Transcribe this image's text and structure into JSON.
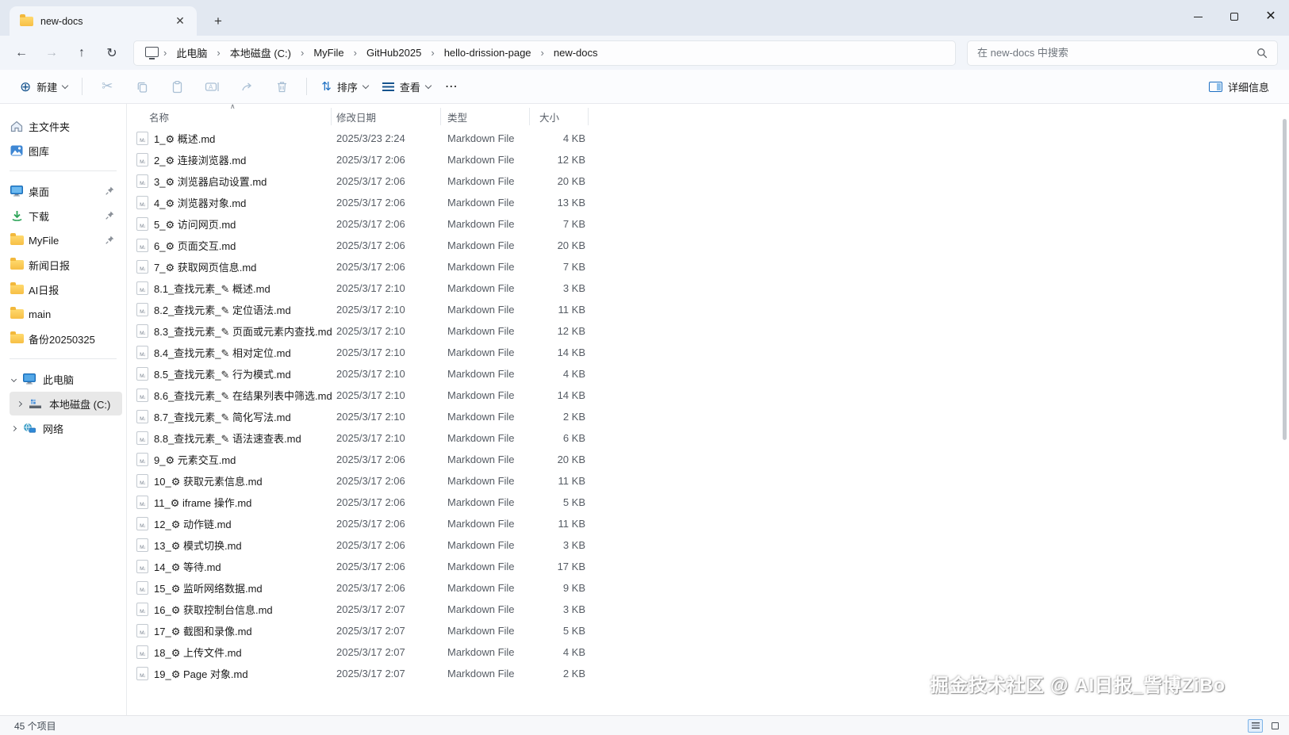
{
  "window": {
    "tab_title": "new-docs"
  },
  "breadcrumb": {
    "items": [
      "此电脑",
      "本地磁盘 (C:)",
      "MyFile",
      "GitHub2025",
      "hello-drission-page",
      "new-docs"
    ]
  },
  "search": {
    "placeholder": "在 new-docs 中搜索"
  },
  "toolbar": {
    "new_label": "新建",
    "sort_label": "排序",
    "view_label": "查看",
    "more_label": "⋯",
    "details_label": "详细信息"
  },
  "sidebar": {
    "home": "主文件夹",
    "gallery": "图库",
    "desktop": "桌面",
    "downloads": "下载",
    "myfile": "MyFile",
    "news_daily": "新闻日报",
    "ai_daily": "AI日报",
    "main": "main",
    "backup": "备份20250325",
    "this_pc": "此电脑",
    "local_disk": "本地磁盘 (C:)",
    "network": "网络"
  },
  "filelist": {
    "columns": {
      "name": "名称",
      "date": "修改日期",
      "type": "类型",
      "size": "大小"
    },
    "rows": [
      {
        "name": "1_⚙ 概述.md",
        "date": "2025/3/23 2:24",
        "type": "Markdown File",
        "size": "4 KB"
      },
      {
        "name": "2_⚙ 连接浏览器.md",
        "date": "2025/3/17 2:06",
        "type": "Markdown File",
        "size": "12 KB"
      },
      {
        "name": "3_⚙ 浏览器启动设置.md",
        "date": "2025/3/17 2:06",
        "type": "Markdown File",
        "size": "20 KB"
      },
      {
        "name": "4_⚙ 浏览器对象.md",
        "date": "2025/3/17 2:06",
        "type": "Markdown File",
        "size": "13 KB"
      },
      {
        "name": "5_⚙ 访问网页.md",
        "date": "2025/3/17 2:06",
        "type": "Markdown File",
        "size": "7 KB"
      },
      {
        "name": "6_⚙ 页面交互.md",
        "date": "2025/3/17 2:06",
        "type": "Markdown File",
        "size": "20 KB"
      },
      {
        "name": "7_⚙ 获取网页信息.md",
        "date": "2025/3/17 2:06",
        "type": "Markdown File",
        "size": "7 KB"
      },
      {
        "name": "8.1_查找元素_✎ 概述.md",
        "date": "2025/3/17 2:10",
        "type": "Markdown File",
        "size": "3 KB"
      },
      {
        "name": "8.2_查找元素_✎ 定位语法.md",
        "date": "2025/3/17 2:10",
        "type": "Markdown File",
        "size": "11 KB"
      },
      {
        "name": "8.3_查找元素_✎ 页面或元素内查找.md",
        "date": "2025/3/17 2:10",
        "type": "Markdown File",
        "size": "12 KB"
      },
      {
        "name": "8.4_查找元素_✎ 相对定位.md",
        "date": "2025/3/17 2:10",
        "type": "Markdown File",
        "size": "14 KB"
      },
      {
        "name": "8.5_查找元素_✎ 行为模式.md",
        "date": "2025/3/17 2:10",
        "type": "Markdown File",
        "size": "4 KB"
      },
      {
        "name": "8.6_查找元素_✎ 在结果列表中筛选.md",
        "date": "2025/3/17 2:10",
        "type": "Markdown File",
        "size": "14 KB"
      },
      {
        "name": "8.7_查找元素_✎ 简化写法.md",
        "date": "2025/3/17 2:10",
        "type": "Markdown File",
        "size": "2 KB"
      },
      {
        "name": "8.8_查找元素_✎ 语法速查表.md",
        "date": "2025/3/17 2:10",
        "type": "Markdown File",
        "size": "6 KB"
      },
      {
        "name": "9_⚙ 元素交互.md",
        "date": "2025/3/17 2:06",
        "type": "Markdown File",
        "size": "20 KB"
      },
      {
        "name": "10_⚙ 获取元素信息.md",
        "date": "2025/3/17 2:06",
        "type": "Markdown File",
        "size": "11 KB"
      },
      {
        "name": "11_⚙ iframe 操作.md",
        "date": "2025/3/17 2:06",
        "type": "Markdown File",
        "size": "5 KB"
      },
      {
        "name": "12_⚙ 动作链.md",
        "date": "2025/3/17 2:06",
        "type": "Markdown File",
        "size": "11 KB"
      },
      {
        "name": "13_⚙ 模式切换.md",
        "date": "2025/3/17 2:06",
        "type": "Markdown File",
        "size": "3 KB"
      },
      {
        "name": "14_⚙ 等待.md",
        "date": "2025/3/17 2:06",
        "type": "Markdown File",
        "size": "17 KB"
      },
      {
        "name": "15_⚙ 监听网络数据.md",
        "date": "2025/3/17 2:06",
        "type": "Markdown File",
        "size": "9 KB"
      },
      {
        "name": "16_⚙ 获取控制台信息.md",
        "date": "2025/3/17 2:07",
        "type": "Markdown File",
        "size": "3 KB"
      },
      {
        "name": "17_⚙ 截图和录像.md",
        "date": "2025/3/17 2:07",
        "type": "Markdown File",
        "size": "5 KB"
      },
      {
        "name": "18_⚙ 上传文件.md",
        "date": "2025/3/17 2:07",
        "type": "Markdown File",
        "size": "4 KB"
      },
      {
        "name": "19_⚙ Page 对象.md",
        "date": "2025/3/17 2:07",
        "type": "Markdown File",
        "size": "2 KB"
      }
    ]
  },
  "statusbar": {
    "count": "45 个项目"
  },
  "watermark": "掘金技术社区 @ AI日报_訾博ZiBo",
  "colors": {
    "accent_blue": "#1b6ec2",
    "folder_yellow": "#f7bf45",
    "titlebar_bg": "#e2e8f1"
  }
}
